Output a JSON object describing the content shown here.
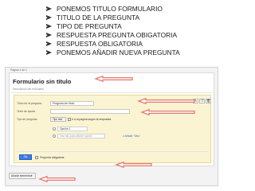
{
  "bullets": [
    "PONEMOS TITULO FORMULARIO",
    "TITULO DE LA PREGUNTA",
    "TIPO DE PREGUNTA",
    "RESPUESTA PREGUNTA OBIGATORIA",
    "RESPUESTA OBLIGATORIA",
    "PONEMOS AÑADIR NUEVA PREGUNTA"
  ],
  "form": {
    "page_label": "Página 1 de 1",
    "title": "Formulario sin título",
    "description": "Descripción del formulario",
    "question": {
      "title_label": "Título de la pregunta",
      "title_value": "Pregunta sin título",
      "help_label": "Texto de ayuda",
      "type_label": "Tipo de pregunta",
      "type_value": "Tipo test",
      "goto_page_label": "Ir a la página según la respuesta",
      "option1": "Opción 1",
      "add_option_placeholder": "Haz clic para añadir opción",
      "add_other_link": "o Añadir \"Otro\"",
      "ok_label": "Ok",
      "required_label": "Pregunta obligatoria"
    },
    "add_element_label": "Añadir elemento"
  },
  "colors": {
    "arrow": "#e8786e",
    "card": "#fbf4d2",
    "ok_button": "#3d7de8"
  }
}
